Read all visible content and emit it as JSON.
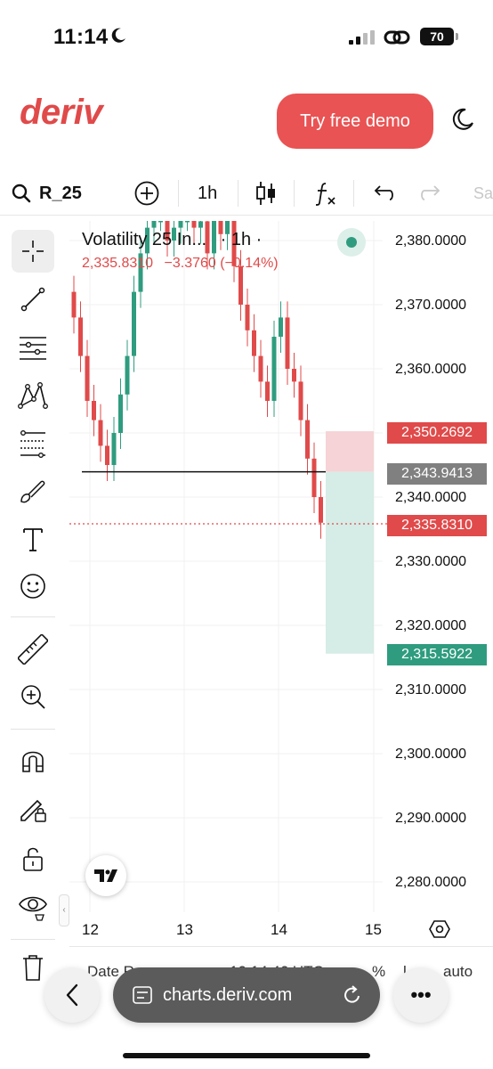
{
  "status_bar": {
    "time": "11:14",
    "battery": "70"
  },
  "header": {
    "logo": "deriv",
    "demo_button": "Try free demo"
  },
  "toolbar": {
    "symbol": "R_25",
    "interval": "1h",
    "save_label": "Sa"
  },
  "legend": {
    "title": "Volatility 25 In...",
    "interval": "· 1h ·",
    "price": "2,335.8310",
    "change": "−3.3760 (−0.14%)"
  },
  "price_axis": [
    "2,380.0000",
    "2,370.0000",
    "2,360.0000",
    "2,340.0000",
    "2,330.0000",
    "2,320.0000",
    "2,310.0000",
    "2,300.0000",
    "2,290.0000",
    "2,280.0000"
  ],
  "price_tags": {
    "stop": "2,350.2692",
    "entry": "2,343.9413",
    "current": "2,335.8310",
    "target": "2,315.5922"
  },
  "colors": {
    "up": "#2f9c7f",
    "down": "#e04a4a",
    "brand": "#e95353",
    "entry_tag": "#808080"
  },
  "date_axis": [
    "12",
    "13",
    "14",
    "15"
  ],
  "bottom_strip": {
    "date_label": "Date R...",
    "time": "10:14:46 UTC",
    "percent": "%",
    "log": "l...",
    "auto": "auto"
  },
  "browser": {
    "url": "charts.deriv.com"
  },
  "chart_data": {
    "type": "candlestick",
    "symbol": "Volatility 25 Index",
    "interval": "1h",
    "ylim": [
      2275,
      2385
    ],
    "x_ticks": [
      "12",
      "13",
      "14",
      "15"
    ],
    "last_price": 2335.831,
    "position": {
      "entry": 2343.9413,
      "stop": 2350.2692,
      "target": 2315.5922
    },
    "candles_close_approx": [
      2368,
      2362,
      2355,
      2352,
      2348,
      2345,
      2350,
      2356,
      2362,
      2372,
      2378,
      2382,
      2384,
      2384,
      2380,
      2382,
      2384,
      2384,
      2382,
      2383,
      2378,
      2384,
      2381,
      2384,
      2376,
      2370,
      2366,
      2362,
      2358,
      2355,
      2365,
      2368,
      2360,
      2358,
      2352,
      2346,
      2340,
      2336
    ]
  }
}
